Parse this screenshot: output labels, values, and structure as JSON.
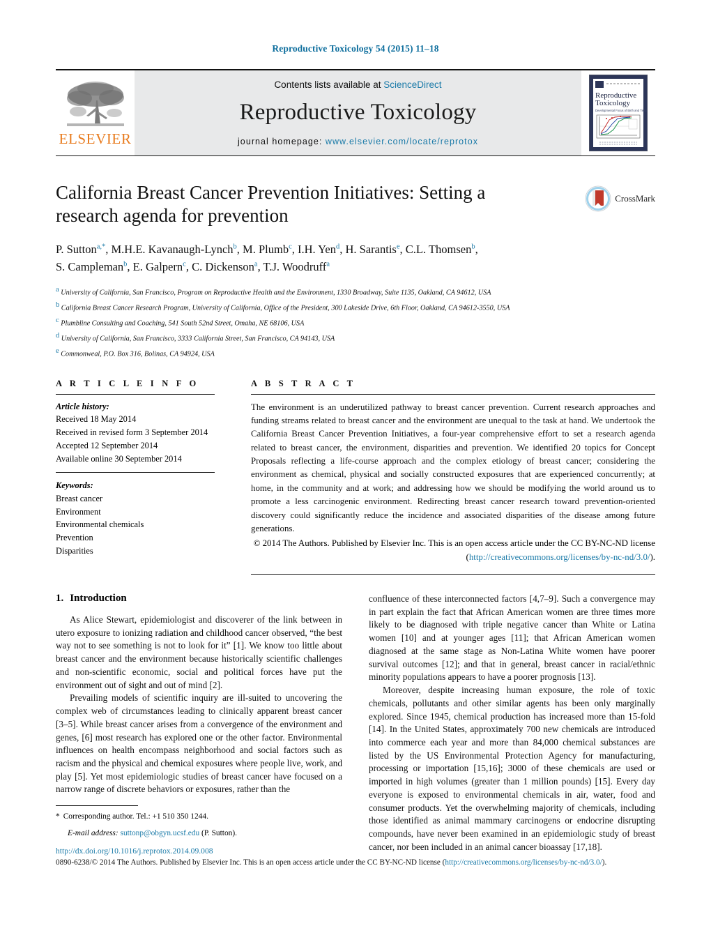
{
  "running_head": "Reproductive Toxicology 54 (2015) 11–18",
  "masthead": {
    "publisher_name": "ELSEVIER",
    "contents_prefix": "Contents lists available at ",
    "contents_link": "ScienceDirect",
    "journal_name": "Reproductive Toxicology",
    "homepage_prefix": "journal homepage: ",
    "homepage_link": "www.elsevier.com/locate/reprotox",
    "cover": {
      "title_line1": "Reproductive",
      "title_line2": "Toxicology",
      "subtitle": "Developmental Focus of Birth and Tissue"
    }
  },
  "article": {
    "title": "California Breast Cancer Prevention Initiatives: Setting a research agenda for prevention",
    "crossmark_label": "CrossMark",
    "authors_line1": "P. Sutton",
    "authors_html": "P. Sutton<sup>a,*</sup>, M.H.E. Kavanaugh-Lynch<sup>b</sup>, M. Plumb<sup>c</sup>, I.H. Yen<sup>d</sup>, H. Sarantis<sup>e</sup>, C.L. Thomsen<sup>b</sup>, S. Campleman<sup>b</sup>, E. Galpern<sup>c</sup>, C. Dickenson<sup>a</sup>, T.J. Woodruff<sup>a</sup>",
    "affiliations": [
      {
        "mark": "a",
        "text": "University of California, San Francisco, Program on Reproductive Health and the Environment, 1330 Broadway, Suite 1135, Oakland, CA 94612, USA"
      },
      {
        "mark": "b",
        "text": "California Breast Cancer Research Program, University of California, Office of the President, 300 Lakeside Drive, 6th Floor, Oakland, CA 94612-3550, USA"
      },
      {
        "mark": "c",
        "text": "Plumbline Consulting and Coaching, 541 South 52nd Street, Omaha, NE 68106, USA"
      },
      {
        "mark": "d",
        "text": "University of California, San Francisco, 3333 California Street, San Francisco, CA 94143, USA"
      },
      {
        "mark": "e",
        "text": "Commonweal, P.O. Box 316, Bolinas, CA 94924, USA"
      }
    ]
  },
  "article_info": {
    "heading": "A R T I C L E   I N F O",
    "history_label": "Article history:",
    "history": [
      "Received 18 May 2014",
      "Received in revised form 3 September 2014",
      "Accepted 12 September 2014",
      "Available online 30 September 2014"
    ],
    "keywords_label": "Keywords:",
    "keywords": [
      "Breast cancer",
      "Environment",
      "Environmental chemicals",
      "Prevention",
      "Disparities"
    ]
  },
  "abstract": {
    "heading": "A B S T R A C T",
    "text": "The environment is an underutilized pathway to breast cancer prevention. Current research approaches and funding streams related to breast cancer and the environment are unequal to the task at hand. We undertook the California Breast Cancer Prevention Initiatives, a four-year comprehensive effort to set a research agenda related to breast cancer, the environment, disparities and prevention. We identified 20 topics for Concept Proposals reflecting a life-course approach and the complex etiology of breast cancer; considering the environment as chemical, physical and socially constructed exposures that are experienced concurrently; at home, in the community and at work; and addressing how we should be modifying the world around us to promote a less carcinogenic environment. Redirecting breast cancer research toward prevention-oriented discovery could significantly reduce the incidence and associated disparities of the disease among future generations.",
    "copyright_text": "© 2014 The Authors. Published by Elsevier Inc. This is an open access article under the CC BY-NC-ND license (",
    "copyright_link": "http://creativecommons.org/licenses/by-nc-nd/3.0/",
    "copyright_tail": ")."
  },
  "body": {
    "section_number": "1.",
    "section_title": "Introduction",
    "left_paragraphs": [
      "As Alice Stewart, epidemiologist and discoverer of the link between in utero exposure to ionizing radiation and childhood cancer observed, “the best way not to see something is not to look for it” [1]. We know too little about breast cancer and the environment because historically scientific challenges and non-scientific economic, social and political forces have put the environment out of sight and out of mind [2].",
      "Prevailing models of scientific inquiry are ill-suited to uncovering the complex web of circumstances leading to clinically apparent breast cancer [3–5]. While breast cancer arises from a convergence of the environment and genes, [6] most research has explored one or the other factor. Environmental influences on health encompass neighborhood and social factors such as racism and the physical and chemical exposures where people live, work, and play [5]. Yet most epidemiologic studies of breast cancer have focused on a narrow range of discrete behaviors or exposures, rather than the"
    ],
    "right_paragraphs": [
      "confluence of these interconnected factors [4,7–9]. Such a convergence may in part explain the fact that African American women are three times more likely to be diagnosed with triple negative cancer than White or Latina women [10] and at younger ages [11]; that African American women diagnosed at the same stage as Non-Latina White women have poorer survival outcomes [12]; and that in general, breast cancer in racial/ethnic minority populations appears to have a poorer prognosis [13].",
      "Moreover, despite increasing human exposure, the role of toxic chemicals, pollutants and other similar agents has been only marginally explored. Since 1945, chemical production has increased more than 15-fold [14]. In the United States, approximately 700 new chemicals are introduced into commerce each year and more than 84,000 chemical substances are listed by the US Environmental Protection Agency for manufacturing, processing or importation [15,16]; 3000 of these chemicals are used or imported in high volumes (greater than 1 million pounds) [15]. Every day everyone is exposed to environmental chemicals in air, water, food and consumer products. Yet the overwhelming majority of chemicals, including those identified as animal mammary carcinogens or endocrine disrupting compounds, have never been examined in an epidemiologic study of breast cancer, nor been included in an animal cancer bioassay [17,18]."
    ]
  },
  "footnote": {
    "star": "*",
    "corresponding": "Corresponding author. Tel.: +1 510 350 1244.",
    "email_label": "E-mail address:",
    "email": "suttonp@obgyn.ucsf.edu",
    "email_suffix": "(P. Sutton)."
  },
  "footer": {
    "doi": "http://dx.doi.org/10.1016/j.reprotox.2014.09.008",
    "issn_text": "0890-6238/© 2014 The Authors. Published by Elsevier Inc. This is an open access article under the CC BY-NC-ND license (",
    "issn_link": "http://creativecommons.org/licenses/by-nc-nd/3.0/",
    "issn_tail": ")."
  },
  "colors": {
    "link": "#1a7aa8",
    "running_head": "#0f6f9e",
    "elsevier_orange": "#E87B1E",
    "masthead_bg": "#e8e9ea"
  }
}
